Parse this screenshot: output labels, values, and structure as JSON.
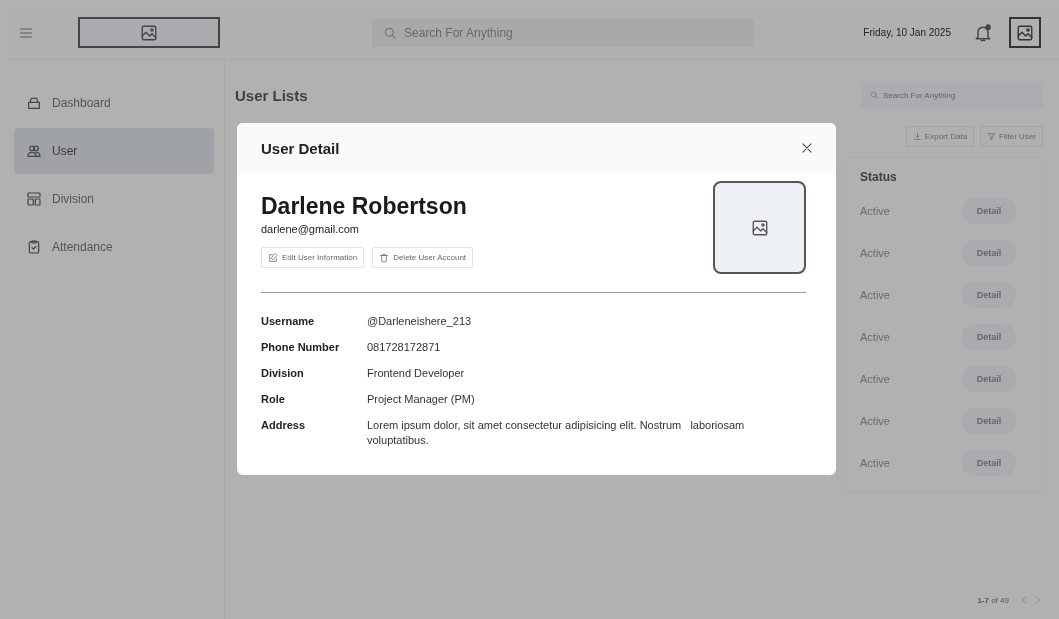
{
  "topbar": {
    "search": {
      "placeholder": "Search For Anything"
    },
    "date": "Friday, 10 Jan 2025"
  },
  "sidebar": {
    "items": [
      {
        "label": "Dashboard",
        "selected": false
      },
      {
        "label": "User",
        "selected": true
      },
      {
        "label": "Division",
        "selected": false
      },
      {
        "label": "Attendance",
        "selected": false
      }
    ]
  },
  "page": {
    "title": "User Lists",
    "search": {
      "placeholder": "Search For Anything"
    },
    "actions": [
      {
        "label": "Export Data"
      },
      {
        "label": "Filter User"
      }
    ]
  },
  "table": {
    "columns": [
      "Status"
    ],
    "rows": [
      {
        "status": "Active",
        "action": "Detail"
      },
      {
        "status": "Active",
        "action": "Detail"
      },
      {
        "status": "Active",
        "action": "Detail"
      },
      {
        "status": "Active",
        "action": "Detail"
      },
      {
        "status": "Active",
        "action": "Detail"
      },
      {
        "status": "Active",
        "action": "Detail"
      },
      {
        "status": "Active",
        "action": "Detail"
      }
    ]
  },
  "pagination": {
    "range": "1-7",
    "total": "of 49"
  },
  "modal": {
    "title": "User Detail",
    "name": "Darlene Robertson",
    "email": "darlene@gmail.com",
    "actions": [
      {
        "label": "Edit User Information"
      },
      {
        "label": "Delete User Account"
      }
    ],
    "fields": [
      {
        "label": "Username",
        "value": "@Darleneishere_213"
      },
      {
        "label": "Phone Number",
        "value": "081728172871"
      },
      {
        "label": "Division",
        "value": "Frontend Developer"
      },
      {
        "label": "Role",
        "value": "Project Manager (PM)"
      },
      {
        "label": "Address",
        "value": "Lorem ipsum dolor, sit amet consectetur adipisicing elit. Nostrum   laboriosam voluptatibus."
      }
    ]
  }
}
